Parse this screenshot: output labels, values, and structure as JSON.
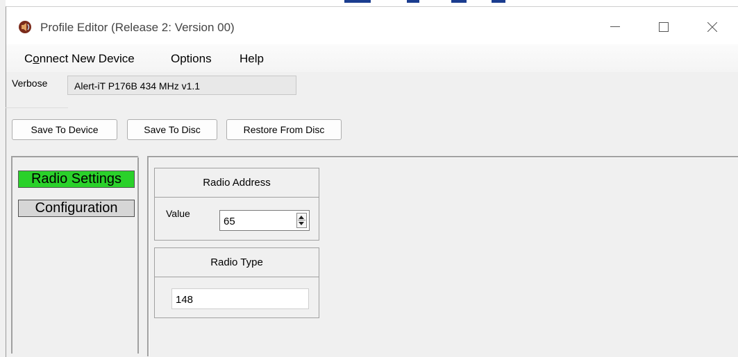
{
  "window": {
    "title": "Profile Editor (Release 2: Version 00)",
    "icon": "speaker-icon"
  },
  "menu": {
    "connect": "Connect New Device",
    "options": "Options",
    "help": "Help"
  },
  "verbose": {
    "label": "Verbose",
    "value": "Alert-iT P176B 434 MHz v1.1"
  },
  "toolbar": {
    "save_to_device": "Save To Device",
    "save_to_disc": "Save To Disc",
    "restore_from_disc": "Restore From Disc"
  },
  "nav": {
    "radio_settings": "Radio Settings",
    "configuration": "Configuration",
    "active_color": "#2ad12a"
  },
  "radio_address": {
    "title": "Radio Address",
    "value_label": "Value",
    "value": "65"
  },
  "radio_type": {
    "title": "Radio Type",
    "value": "148"
  }
}
